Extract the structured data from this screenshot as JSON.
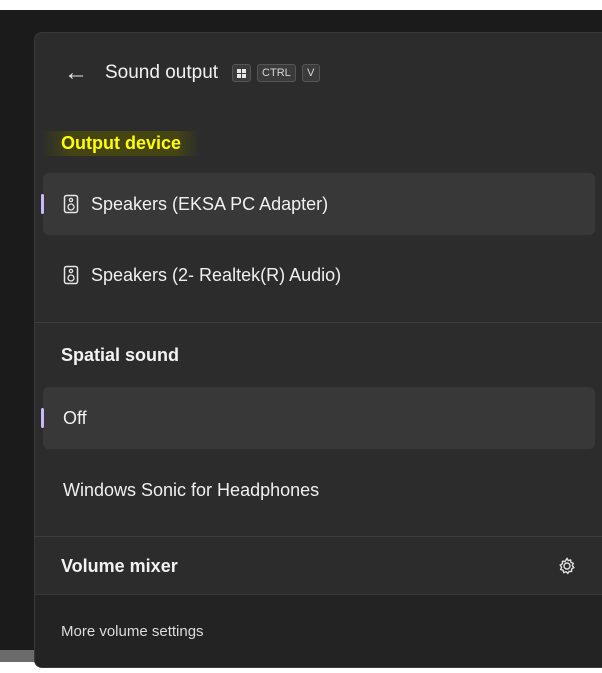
{
  "header": {
    "back_icon": "arrow-left-icon",
    "title": "Sound output",
    "shortcut": {
      "win_key_icon": "windows-key-icon",
      "ctrl": "CTRL",
      "v": "V"
    }
  },
  "output_device": {
    "title": "Output device",
    "highlight_color": "#ffff00",
    "items": [
      {
        "icon": "speaker-icon",
        "label": "Speakers (EKSA PC Adapter)",
        "selected": true
      },
      {
        "icon": "speaker-icon",
        "label": "Speakers (2- Realtek(R) Audio)",
        "selected": false
      }
    ]
  },
  "spatial_sound": {
    "title": "Spatial sound",
    "items": [
      {
        "label": "Off",
        "selected": true
      },
      {
        "label": "Windows Sonic for Headphones",
        "selected": false
      }
    ]
  },
  "volume_mixer": {
    "title": "Volume mixer",
    "settings_icon": "gear-icon"
  },
  "footer": {
    "link": "More volume settings"
  },
  "colors": {
    "accent": "#c9b8ff",
    "panel_bg": "#2c2c2c",
    "selected_bg": "#383838"
  }
}
